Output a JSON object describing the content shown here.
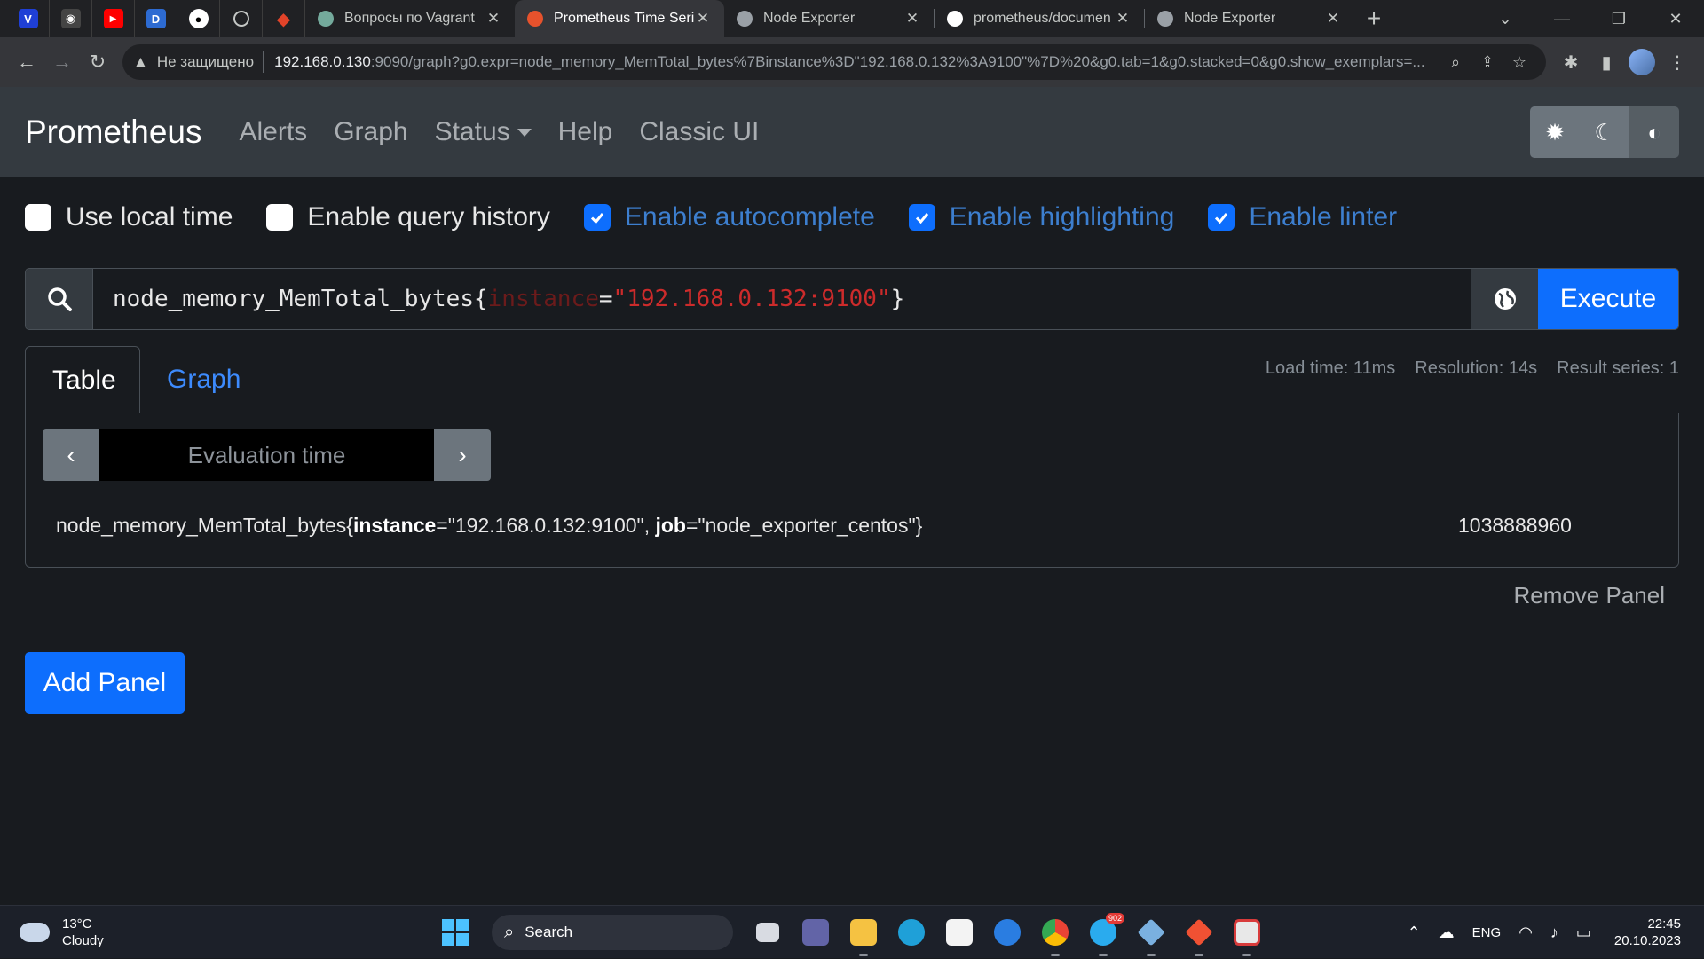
{
  "browser": {
    "pinned_tabs": [
      {
        "icon": "vivaldi-icon",
        "color": "#1f3fd6",
        "glyph": "V"
      },
      {
        "icon": "extension-icon",
        "color": "#444",
        "glyph": "◉"
      },
      {
        "icon": "youtube-icon",
        "color": "#ff0000",
        "glyph": "▶"
      },
      {
        "icon": "dj-icon",
        "color": "#2d6bd2",
        "glyph": "D"
      },
      {
        "icon": "github-icon",
        "color": "#000",
        "glyph": "●"
      },
      {
        "icon": "globe-icon",
        "color": "#444",
        "glyph": "◍"
      },
      {
        "icon": "gitlab-icon",
        "color": "#e24329",
        "glyph": "◆"
      }
    ],
    "tabs": [
      {
        "title": "Вопросы по Vagrant",
        "favicon_color": "#74aa9c",
        "active": false
      },
      {
        "title": "Prometheus Time Serie",
        "favicon_color": "#e6522c",
        "active": true
      },
      {
        "title": "Node Exporter",
        "favicon_color": "#9aa0a6",
        "active": false
      },
      {
        "title": "prometheus/documen",
        "favicon_color": "#ffffff",
        "active": false
      },
      {
        "title": "Node Exporter",
        "favicon_color": "#9aa0a6",
        "active": false
      }
    ],
    "address": {
      "security_text": "Не защищено",
      "host": "192.168.0.130",
      "rest": ":9090/graph?g0.expr=node_memory_MemTotal_bytes%7Binstance%3D\"192.168.0.132%3A9100\"%7D%20&g0.tab=1&g0.stacked=0&g0.show_exemplars=..."
    }
  },
  "nav": {
    "brand": "Prometheus",
    "links": [
      "Alerts",
      "Graph",
      "Status",
      "Help",
      "Classic UI"
    ]
  },
  "options": [
    {
      "label": "Use local time",
      "checked": false
    },
    {
      "label": "Enable query history",
      "checked": false
    },
    {
      "label": "Enable autocomplete",
      "checked": true
    },
    {
      "label": "Enable highlighting",
      "checked": true
    },
    {
      "label": "Enable linter",
      "checked": true
    }
  ],
  "query": {
    "metric": "node_memory_MemTotal_bytes",
    "open": "{",
    "label": "instance",
    "eq": "=",
    "value": "\"192.168.0.132:9100\"",
    "close": "}",
    "execute_label": "Execute"
  },
  "panel": {
    "tab_table": "Table",
    "tab_graph": "Graph",
    "load_time": "Load time: 11ms",
    "resolution": "Resolution: 14s",
    "result_series": "Result series: 1",
    "eval_placeholder": "Evaluation time",
    "result": {
      "metric_name": "node_memory_MemTotal_bytes",
      "open": "{",
      "l1": "instance",
      "v1": "=\"192.168.0.132:9100\", ",
      "l2": "job",
      "v2": "=\"node_exporter_centos\"",
      "close": "}",
      "value": "1038888960"
    },
    "remove_label": "Remove Panel"
  },
  "add_panel_label": "Add Panel",
  "taskbar": {
    "temp": "13°C",
    "condition": "Cloudy",
    "search_label": "Search",
    "lang": "ENG",
    "time": "22:45",
    "date": "20.10.2023",
    "telegram_badge": "902"
  }
}
